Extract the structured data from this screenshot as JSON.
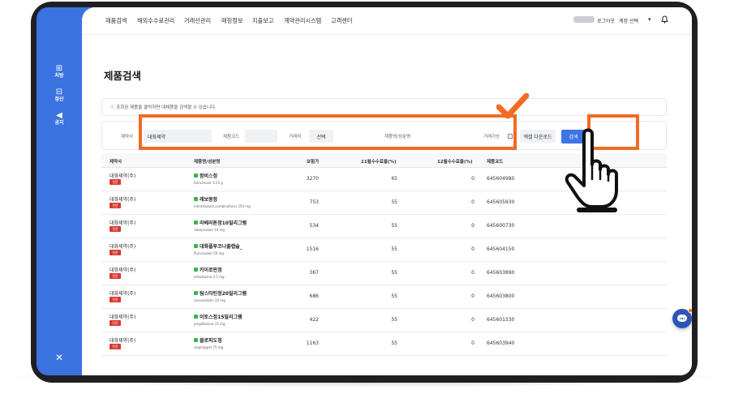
{
  "sidebar": {
    "items": [
      {
        "icon": "prescription-icon",
        "glyph": "⊞",
        "label": "처방"
      },
      {
        "icon": "settlement-icon",
        "glyph": "⊟",
        "label": "정산"
      },
      {
        "icon": "announcement-icon",
        "glyph": "◀",
        "label": "공지"
      }
    ],
    "settings_icon": "✕"
  },
  "nav": {
    "items": [
      "제품검색",
      "해외수수료관리",
      "거래선관리",
      "매핑정보",
      "지출보고",
      "계약관리시스템",
      "고객센터"
    ],
    "logout": "로그아웃",
    "account_select": "계정 선택",
    "chevron": "▾",
    "bell": "♫"
  },
  "page": {
    "title": "제품검색",
    "info": "ⓘ 조회된 제품을 클릭하면 대체품을 검색할 수 있습니다."
  },
  "filter": {
    "maker_label": "제약사",
    "maker_value": "대화제약",
    "code_label": "제품코드",
    "partner_label": "거래처",
    "partner_select": "선택",
    "product_label": "제품명/성분명",
    "tradable_label": "거래가능",
    "excel_button": "엑셀 다운로드",
    "search_button": "검색"
  },
  "table": {
    "headers": [
      "제약사",
      "제품명/성분명",
      "보험가",
      "11월수수료율(%)",
      "12월수수료율(%)",
      "제품코드"
    ],
    "rows": [
      {
        "maker": "대화제약(주)",
        "badge": "전문",
        "product": "팜비스정",
        "ingredient": "famciclovir 0.25 g",
        "price": "3270",
        "rate11": "65",
        "rate12": "0",
        "code": "645604980"
      },
      {
        "maker": "대화제약(주)",
        "badge": "전문",
        "product": "레보몽정",
        "ingredient": "montelukast,combinations 250 mg",
        "price": "753",
        "rate11": "55",
        "rate12": "0",
        "code": "645605930"
      },
      {
        "maker": "대화제약(주)",
        "badge": "전문",
        "product": "라베라톤정10밀리그램",
        "ingredient": "rabeprazole 10 mg",
        "price": "534",
        "rate11": "55",
        "rate12": "0",
        "code": "645600730"
      },
      {
        "maker": "대화제약(주)",
        "badge": "전문",
        "product": "대화플루코나졸캡슐_",
        "ingredient": "fluconazole 50 mg",
        "price": "1516",
        "rate11": "55",
        "rate12": "0",
        "code": "645604150"
      },
      {
        "maker": "대화제약(주)",
        "badge": "전문",
        "product": "카이로핀정",
        "ingredient": "amlodipine 2.5 mg",
        "price": "367",
        "rate11": "55",
        "rate12": "0",
        "code": "645603890"
      },
      {
        "maker": "대화제약(주)",
        "badge": "전문",
        "product": "팀스타틴정20밀리그램",
        "ingredient": "rosuvastatin 20 mg",
        "price": "686",
        "rate11": "55",
        "rate12": "0",
        "code": "645603800"
      },
      {
        "maker": "대화제약(주)",
        "badge": "전문",
        "product": "이토스정15밀리그램",
        "ingredient": "pioglitazone 15 mg",
        "price": "422",
        "rate11": "55",
        "rate12": "0",
        "code": "645601330"
      },
      {
        "maker": "대화제약(주)",
        "badge": "전문",
        "product": "클로피도정",
        "ingredient": "clopidogrel 75 mg",
        "price": "1163",
        "rate11": "55",
        "rate12": "0",
        "code": "645603940"
      }
    ]
  },
  "colors": {
    "brand_blue": "#3a72e0",
    "highlight_orange": "#f26b22",
    "badge_red": "#d8372f",
    "dot_green": "#3bb54a"
  }
}
